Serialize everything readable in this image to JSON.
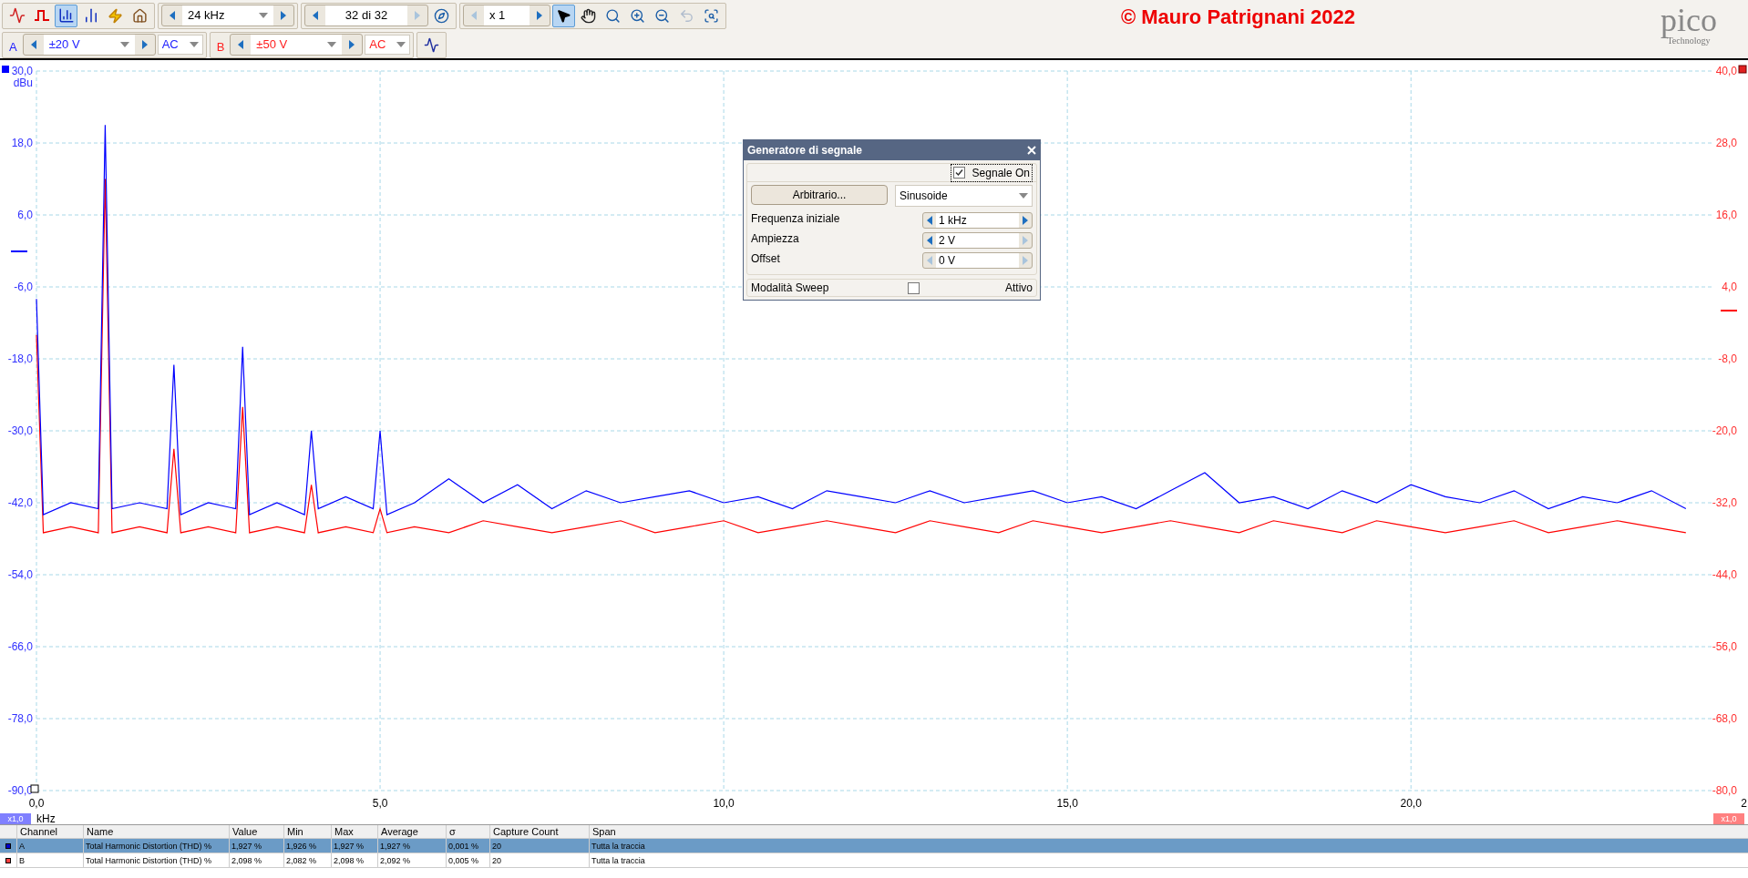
{
  "toolbar": {
    "view_modes": [
      {
        "selected": false
      },
      {
        "selected": false
      },
      {
        "selected": true
      },
      {
        "selected": false
      }
    ],
    "frequency_range": {
      "value": "24 kHz",
      "prev_disabled": false,
      "next_disabled": false
    },
    "buffer": {
      "value": "32 di 32",
      "prev_disabled": false,
      "next_disabled": true
    },
    "zoom": {
      "value": "x 1",
      "prev_disabled": true,
      "next_disabled": false
    },
    "tools": [
      {
        "kind": "pointer",
        "selected": true,
        "disabled": false
      },
      {
        "kind": "hand",
        "selected": false,
        "disabled": false
      },
      {
        "kind": "zoom",
        "selected": false,
        "disabled": false
      },
      {
        "kind": "zoom-in",
        "selected": false,
        "disabled": false
      },
      {
        "kind": "zoom-out",
        "selected": false,
        "disabled": false
      },
      {
        "kind": "undo",
        "selected": false,
        "disabled": true
      },
      {
        "kind": "zoom-fit",
        "selected": false,
        "disabled": false
      }
    ],
    "copyright": "© Mauro Patrignani 2022",
    "logo": {
      "name": "pico",
      "tagline": "Technology"
    }
  },
  "channels": [
    {
      "name": "A",
      "range": "±20 V",
      "coupling": "AC",
      "color": "#2020ff"
    },
    {
      "name": "B",
      "range": "±50 V",
      "coupling": "AC",
      "color": "#ff2020"
    }
  ],
  "chart": {
    "right_ticks": [
      "40,0",
      "28,0",
      "16,0",
      "4,0",
      "-8,0",
      "-20,0",
      "-32,0",
      "-44,0",
      "-56,0",
      "-68,0",
      "-80,0"
    ],
    "cut_x_label": "2",
    "left_scale": "x1,0",
    "right_scale": "x1,0",
    "chart_data": {
      "type": "line",
      "grid": true,
      "xlabel": "kHz",
      "ylabel": "dBu",
      "xlim": [
        0,
        24.4
      ],
      "ylim": [
        -90,
        30
      ],
      "xticks": [
        {
          "value": 0,
          "label": "0,0"
        },
        {
          "value": 5,
          "label": "5,0"
        },
        {
          "value": 10,
          "label": "10,0"
        },
        {
          "value": 15,
          "label": "15,0"
        },
        {
          "value": 20,
          "label": "20,0"
        }
      ],
      "yticks": [
        {
          "value": 30,
          "label": "30,0"
        },
        {
          "value": 18,
          "label": "18,0"
        },
        {
          "value": 6,
          "label": "6,0"
        },
        {
          "value": -6,
          "label": "-6,0"
        },
        {
          "value": -18,
          "label": "-18,0"
        },
        {
          "value": -30,
          "label": "-30,0"
        },
        {
          "value": -42,
          "label": "-42,0"
        },
        {
          "value": -54,
          "label": "-54,0"
        },
        {
          "value": -66,
          "label": "-66,0"
        },
        {
          "value": -78,
          "label": "-78,0"
        },
        {
          "value": -90,
          "label": "-90,0"
        }
      ],
      "x": [
        0,
        0.1,
        0.5,
        0.9,
        1,
        1.1,
        1.5,
        1.9,
        2,
        2.1,
        2.5,
        2.9,
        3,
        3.1,
        3.5,
        3.9,
        4,
        4.1,
        4.5,
        4.9,
        5,
        5.1,
        5.5,
        6,
        6.5,
        7,
        7.5,
        8,
        8.5,
        9,
        9.5,
        10,
        10.5,
        11,
        11.5,
        12,
        12.5,
        13,
        13.5,
        14,
        14.5,
        15,
        15.5,
        16,
        16.5,
        17,
        17.5,
        18,
        18.5,
        19,
        19.5,
        20,
        20.5,
        21,
        21.5,
        22,
        22.5,
        23,
        23.5,
        24
      ],
      "series": [
        {
          "color": "#0000ff",
          "values": [
            -8,
            -44,
            -42,
            -43,
            21,
            -43,
            -42,
            -43,
            -19,
            -44,
            -42,
            -43,
            -16,
            -44,
            -42,
            -44,
            -30,
            -43,
            -41,
            -43,
            -30,
            -44,
            -42,
            -38,
            -42,
            -39,
            -43,
            -40,
            -42,
            -41,
            -40,
            -42,
            -41,
            -43,
            -40,
            -41,
            -42,
            -40,
            -42,
            -41,
            -40,
            -42,
            -41,
            -43,
            -40,
            -37,
            -42,
            -41,
            -43,
            -40,
            -42,
            -39,
            -41,
            -42,
            -40,
            -43,
            -41,
            -42,
            -40,
            -43
          ]
        },
        {
          "color": "#ff0000",
          "values": [
            -14,
            -47,
            -46,
            -47,
            12,
            -47,
            -46,
            -47,
            -33,
            -47,
            -46,
            -47,
            -26,
            -47,
            -46,
            -47,
            -39,
            -47,
            -46,
            -47,
            -43,
            -47,
            -46,
            -47,
            -45,
            -46,
            -47,
            -46,
            -45,
            -47,
            -46,
            -45,
            -47,
            -46,
            -45,
            -46,
            -47,
            -45,
            -46,
            -47,
            -45,
            -46,
            -47,
            -46,
            -45,
            -46,
            -47,
            -45,
            -46,
            -47,
            -45,
            -46,
            -47,
            -46,
            -45,
            -47,
            -46,
            -45,
            -46,
            -47
          ]
        }
      ]
    }
  },
  "generator": {
    "title": "Generatore di segnale",
    "signal_on": {
      "label": "Segnale On",
      "checked": true
    },
    "arbitrary_button": "Arbitrario...",
    "waveform": "Sinusoide",
    "fields": [
      {
        "label": "Frequenza iniziale",
        "value": "1 kHz",
        "prev_disabled": false,
        "next_disabled": false
      },
      {
        "label": "Ampiezza",
        "value": "2 V",
        "prev_disabled": false,
        "next_disabled": true
      },
      {
        "label": "Offset",
        "value": "0 V",
        "prev_disabled": true,
        "next_disabled": true
      }
    ],
    "sweep": {
      "label": "Modalità Sweep",
      "checked": false,
      "option": "Attivo"
    }
  },
  "measurements": {
    "columns": [
      "Channel",
      "Name",
      "Value",
      "Min",
      "Max",
      "Average",
      "σ",
      "Capture Count",
      "Span"
    ],
    "rows": [
      {
        "color": "#0000cc",
        "selected": true,
        "cells": [
          "A",
          "Total Harmonic Distortion (THD) %",
          "1,927 %",
          "1,926 %",
          "1,927 %",
          "1,927 %",
          "0,001 %",
          "20",
          "Tutta la traccia"
        ]
      },
      {
        "color": "#ff4040",
        "selected": false,
        "cells": [
          "B",
          "Total Harmonic Distortion (THD) %",
          "2,098 %",
          "2,082 %",
          "2,098 %",
          "2,092 %",
          "0,005 %",
          "20",
          "Tutta la traccia"
        ]
      }
    ]
  }
}
